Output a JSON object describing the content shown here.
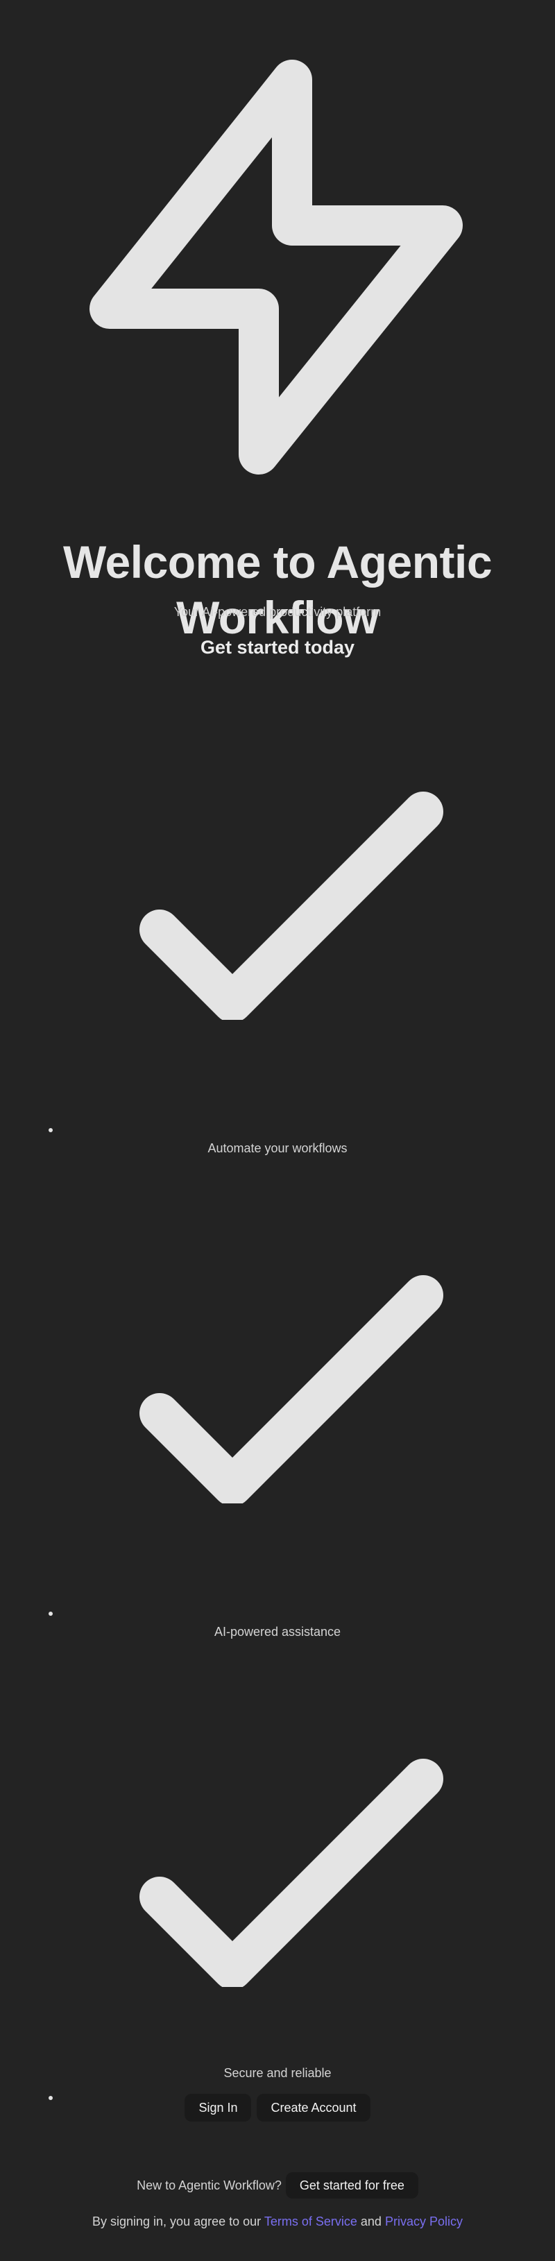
{
  "hero": {
    "icon": "lightning-bolt-icon",
    "title": "Welcome to Agentic Workflow",
    "subtitle": "Your AI-powered productivity platform",
    "cta_heading": "Get started today"
  },
  "features": [
    {
      "icon": "checkmark-icon",
      "label": "Automate your workflows"
    },
    {
      "icon": "checkmark-icon",
      "label": "AI-powered assistance"
    },
    {
      "icon": "checkmark-icon",
      "label": "Secure and reliable"
    }
  ],
  "actions": {
    "sign_in": "Sign In",
    "create_account": "Create Account"
  },
  "signup": {
    "prompt": "New to Agentic Workflow?",
    "button": "Get started for free"
  },
  "legal": {
    "prefix": "By signing in, you agree to our",
    "terms": "Terms of Service",
    "conjunction": "and",
    "privacy": "Privacy Policy"
  },
  "colors": {
    "background": "#232323",
    "foreground": "#e4e4e4",
    "button_bg": "#1a1a1a",
    "link": "#7a6ff0"
  }
}
